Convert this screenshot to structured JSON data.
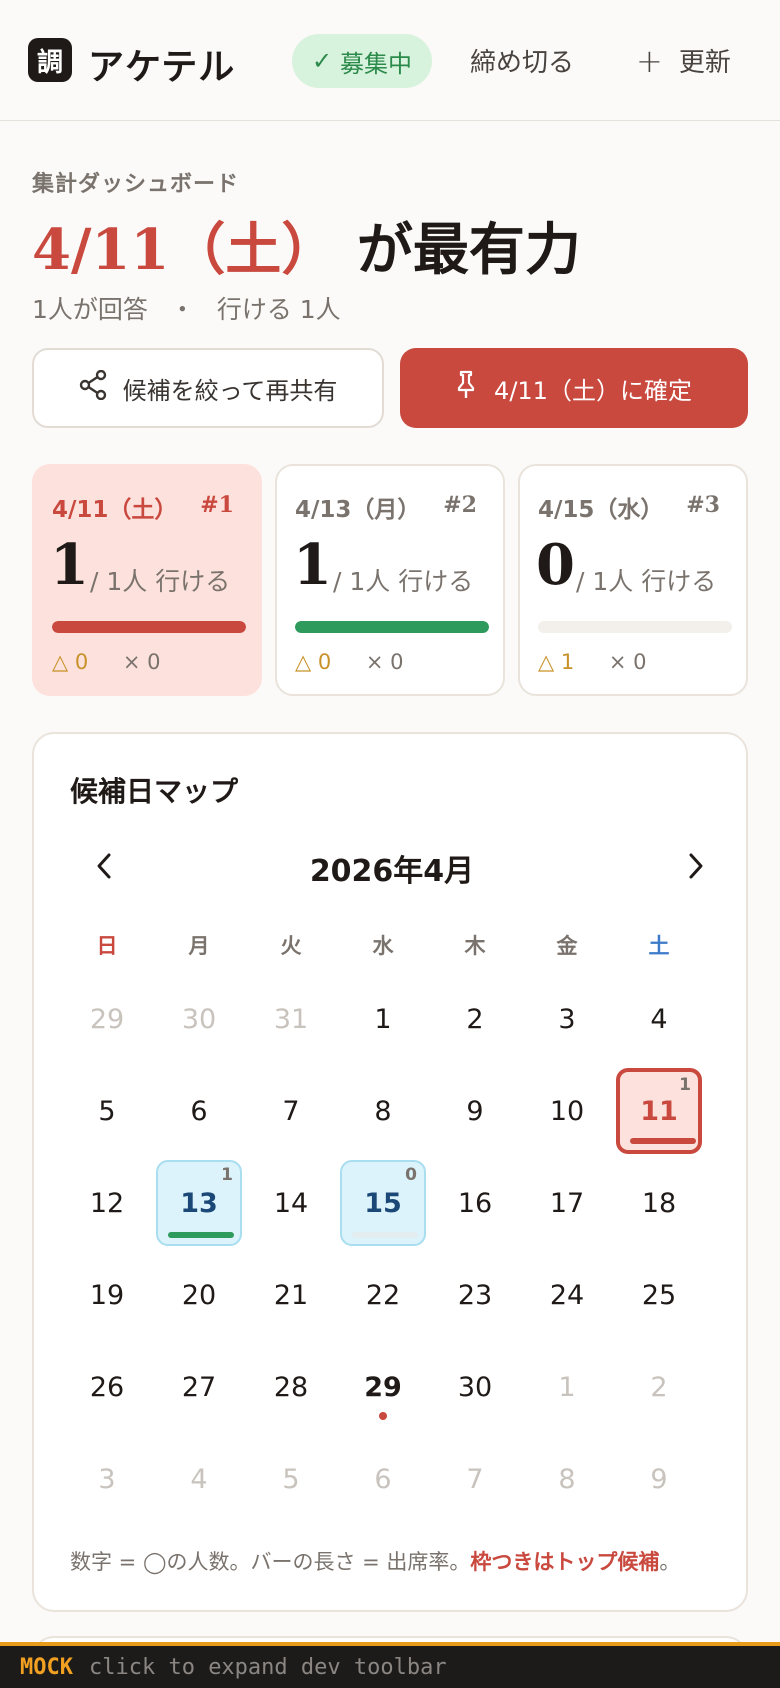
{
  "header": {
    "logo_char": "調",
    "app_title": "アケテル",
    "status_badge": "募集中",
    "close_label": "締め切る",
    "refresh_label": "更新"
  },
  "summary": {
    "section_label": "集計ダッシュボード",
    "headline_date": "4/11（土）",
    "headline_rest": "が最有力",
    "respondents": "1人が回答",
    "separator": "・",
    "available": "行ける 1人"
  },
  "actions": {
    "reshare_label": "候補を絞って再共有",
    "confirm_label": "4/11（土）に確定"
  },
  "candidates": [
    {
      "date": "4/11（土）",
      "rank": "#1",
      "count": "1",
      "total": "/ 1人 行ける",
      "attendance": 1.0,
      "maybe": "△ 0",
      "no": "× 0",
      "bar_color": "#c9493f"
    },
    {
      "date": "4/13（月）",
      "rank": "#2",
      "count": "1",
      "total": "/ 1人 行ける",
      "attendance": 1.0,
      "maybe": "△ 0",
      "no": "× 0",
      "bar_color": "#2e9a5c"
    },
    {
      "date": "4/15（水）",
      "rank": "#3",
      "count": "0",
      "total": "/ 1人 行ける",
      "attendance": 0.0,
      "maybe": "△ 1",
      "no": "× 0",
      "bar_color": "#2e9a5c"
    }
  ],
  "calendar": {
    "title": "候補日マップ",
    "month_label": "2026年4月",
    "weekdays": [
      "日",
      "月",
      "火",
      "水",
      "木",
      "金",
      "土"
    ],
    "weeks": [
      [
        "29",
        "30",
        "31",
        "1",
        "2",
        "3",
        "4"
      ],
      [
        "5",
        "6",
        "7",
        "8",
        "9",
        "10",
        "11"
      ],
      [
        "12",
        "13",
        "14",
        "15",
        "16",
        "17",
        "18"
      ],
      [
        "19",
        "20",
        "21",
        "22",
        "23",
        "24",
        "25"
      ],
      [
        "26",
        "27",
        "28",
        "29",
        "30",
        "1",
        "2"
      ],
      [
        "3",
        "4",
        "5",
        "6",
        "7",
        "8",
        "9"
      ]
    ],
    "muted_cells": [
      [
        0,
        0
      ],
      [
        0,
        1
      ],
      [
        0,
        2
      ],
      [
        4,
        5
      ],
      [
        4,
        6
      ],
      [
        5,
        0
      ],
      [
        5,
        1
      ],
      [
        5,
        2
      ],
      [
        5,
        3
      ],
      [
        5,
        4
      ],
      [
        5,
        5
      ],
      [
        5,
        6
      ]
    ],
    "today_cell": [
      4,
      3
    ],
    "candidate_cells": [
      {
        "week": 1,
        "day": 6,
        "count": "1",
        "attendance": 1.0,
        "top": true,
        "bar_color": "#c9493f"
      },
      {
        "week": 2,
        "day": 1,
        "count": "1",
        "attendance": 1.0,
        "top": false,
        "bar_color": "#2e9a5c"
      },
      {
        "week": 2,
        "day": 3,
        "count": "0",
        "attendance": 0.0,
        "top": false,
        "bar_color": "#2e9a5c"
      }
    ],
    "note_text": "数字 = ◯の人数。バーの長さ = 出席率。",
    "note_emphasis": "枠つきはトップ候補",
    "note_end": "。"
  },
  "toolbar": {
    "mock_label": "MOCK",
    "hint": "click to expand dev toolbar"
  },
  "colors": {
    "accent": "#c9493f",
    "available_green": "#2e9a5c",
    "candidate_blue": "#dcf3fb"
  }
}
